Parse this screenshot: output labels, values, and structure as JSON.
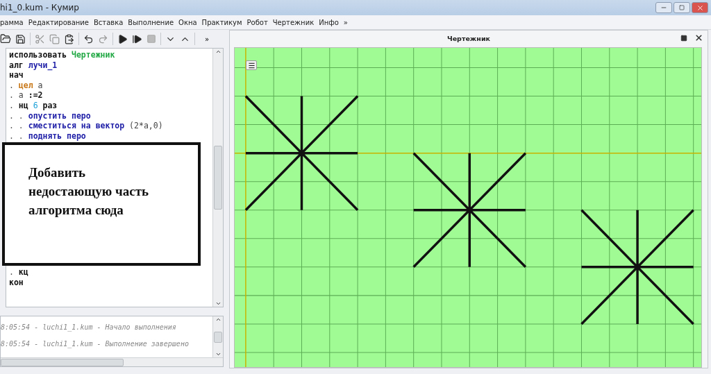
{
  "window": {
    "title": "hi1_0.kum - Кумир"
  },
  "menu": [
    "рамма",
    "Редактирование",
    "Вставка",
    "Выполнение",
    "Окна",
    "Практикум",
    "Робот",
    "Чертежник",
    "Инфо",
    "»"
  ],
  "toolbar": {
    "overflow": "»"
  },
  "code": [
    [
      {
        "kind": "keyword",
        "text": "использовать"
      },
      {
        "kind": "actor",
        "text": "Чертежник"
      }
    ],
    [
      {
        "kind": "keyword",
        "text": "алг"
      },
      {
        "kind": "algo",
        "text": "лучи_1"
      }
    ],
    [
      {
        "kind": "keyword",
        "text": "нач"
      }
    ],
    [
      {
        "kind": "dot",
        "text": "."
      },
      {
        "kind": "type",
        "text": "цел"
      },
      {
        "kind": "var",
        "text": "а"
      }
    ],
    [
      {
        "kind": "dot",
        "text": "."
      },
      {
        "kind": "var",
        "text": "а"
      },
      {
        "kind": "keyword",
        "text": ":=2"
      }
    ],
    [
      {
        "kind": "dot",
        "text": "."
      },
      {
        "kind": "keyword",
        "text": "нц"
      },
      {
        "kind": "num",
        "text": "6"
      },
      {
        "kind": "keyword",
        "text": "раз"
      }
    ],
    [
      {
        "kind": "dot",
        "text": ". ."
      },
      {
        "kind": "algo",
        "text": "опустить перо"
      }
    ],
    [
      {
        "kind": "dot",
        "text": ". ."
      },
      {
        "kind": "algo",
        "text": "сместиться на вектор"
      },
      {
        "kind": "var",
        "text": "(2*а,0)"
      }
    ],
    [
      {
        "kind": "dot",
        "text": ". ."
      },
      {
        "kind": "algo",
        "text": "поднять перо"
      }
    ]
  ],
  "note": "Добавить недостающую часть алгоритма сюда",
  "code_end": [
    [
      {
        "kind": "dot",
        "text": "."
      },
      {
        "kind": "keyword",
        "text": "кц"
      }
    ],
    [
      {
        "kind": "keyword",
        "text": "кон"
      }
    ]
  ],
  "log": [
    "8:05:54 - luchi1_1.kum - Начало выполнения",
    "8:05:54 - luchi1_1.kum - Выполнение завершено"
  ],
  "drawer": {
    "title": "Чертежник"
  }
}
